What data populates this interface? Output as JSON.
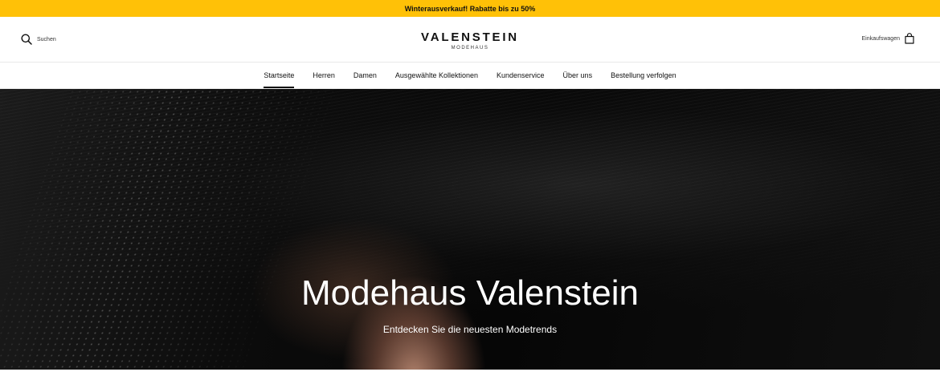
{
  "announcement": {
    "text": "Winterausverkauf! Rabatte bis zu 50%",
    "background": "#ffc107"
  },
  "header": {
    "search": {
      "label": "Suchen",
      "icon": "search-icon"
    },
    "logo": {
      "brand": "VALENSTEIN",
      "subtitle": "MODEHAUS"
    },
    "cart": {
      "label": "Einkaufswagen",
      "icon": "shopping-bag-icon"
    }
  },
  "nav": {
    "items": [
      {
        "label": "Startseite",
        "active": true
      },
      {
        "label": "Herren",
        "active": false
      },
      {
        "label": "Damen",
        "active": false
      },
      {
        "label": "Ausgewählte Kollektionen",
        "active": false
      },
      {
        "label": "Kundenservice",
        "active": false
      },
      {
        "label": "Über uns",
        "active": false
      },
      {
        "label": "Bestellung verfolgen",
        "active": false
      }
    ]
  },
  "hero": {
    "title": "Modehaus Valenstein",
    "subtitle": "Entdecken Sie die neuesten Modetrends"
  }
}
